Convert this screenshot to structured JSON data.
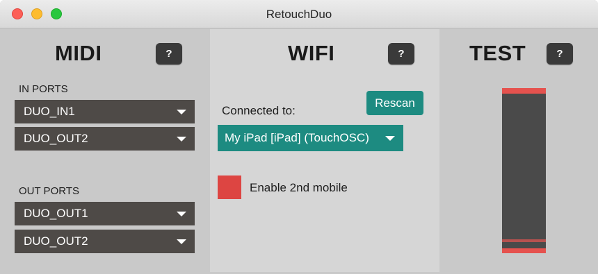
{
  "window": {
    "title": "RetouchDuo"
  },
  "midi": {
    "title": "MIDI",
    "help_label": "?",
    "in_ports_label": "IN PORTS",
    "in_ports": [
      "DUO_IN1",
      "DUO_OUT2"
    ],
    "out_ports_label": "OUT PORTS",
    "out_ports": [
      "DUO_OUT1",
      "DUO_OUT2"
    ]
  },
  "wifi": {
    "title": "WIFI",
    "help_label": "?",
    "rescan_label": "Rescan",
    "connected_label": "Connected to:",
    "selected_device": "My iPad [iPad] (TouchOSC)",
    "enable_second_label": "Enable 2nd mobile"
  },
  "test": {
    "title": "TEST",
    "help_label": "?"
  },
  "colors": {
    "teal_accent": "#1d8b81",
    "red_accent": "#dd4542",
    "dropdown_bg": "#4e4a47",
    "help_bg": "#3a3a3a"
  },
  "icons": {
    "dropdown": "chevron-down-icon",
    "close": "close-icon",
    "minimize": "minimize-icon",
    "maximize": "maximize-icon"
  }
}
